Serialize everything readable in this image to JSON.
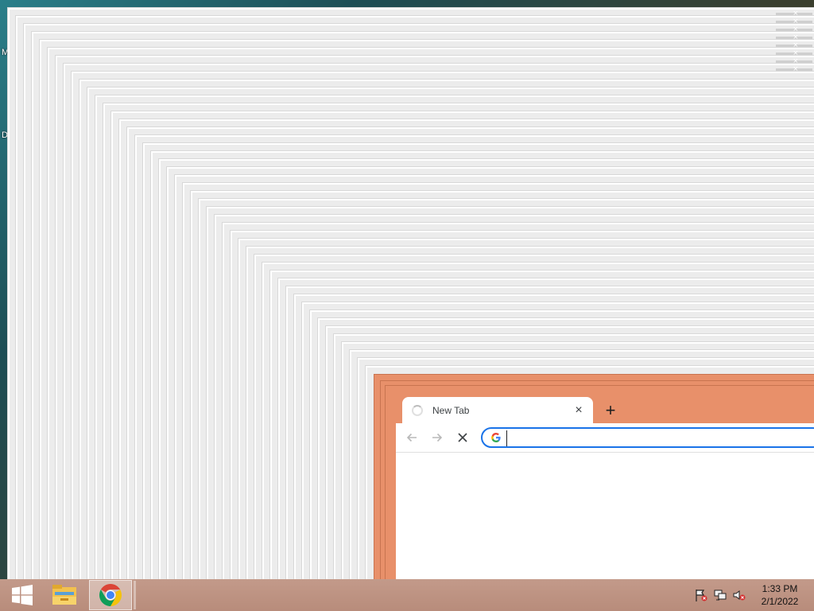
{
  "desktop": {
    "icon_labels": [
      "M",
      "D"
    ]
  },
  "browser": {
    "tab_title": "New Tab",
    "tab_close_symbol": "×",
    "new_tab_symbol": "+",
    "back_icon": "arrow-left-icon",
    "forward_icon": "arrow-right-icon",
    "stop_icon": "close-icon",
    "omnibox_value": "",
    "frame_color": "#e8906a",
    "accent_color": "#1a73e8"
  },
  "taskbar": {
    "start_icon": "windows-logo-icon",
    "pinned_apps": [
      "file-explorer",
      "google-chrome"
    ],
    "tray_icons": [
      "action-center-flag-icon",
      "network-icon",
      "volume-muted-icon"
    ],
    "clock_time": "1:33 PM",
    "clock_date": "2/1/2022"
  }
}
